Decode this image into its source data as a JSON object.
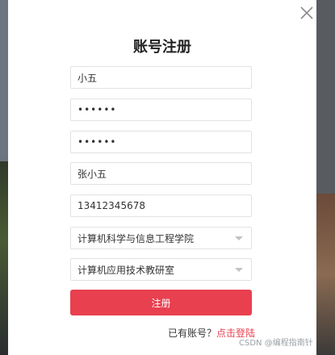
{
  "modal": {
    "title": "账号注册",
    "fields": {
      "username": "小五",
      "password": "••••••",
      "confirm_password": "••••••",
      "real_name": "张小五",
      "phone": "13412345678"
    },
    "selects": {
      "college": "计算机科学与信息工程学院",
      "department": "计算机应用技术教研室"
    },
    "submit_label": "注册",
    "login_prompt": "已有账号？",
    "login_link": "点击登陆"
  },
  "watermark": "CSDN @编程指南针",
  "colors": {
    "primary": "#e8404f",
    "border": "#e2e2e2"
  },
  "icons": {
    "close": "close-icon",
    "dropdown": "chevron-down-icon"
  }
}
